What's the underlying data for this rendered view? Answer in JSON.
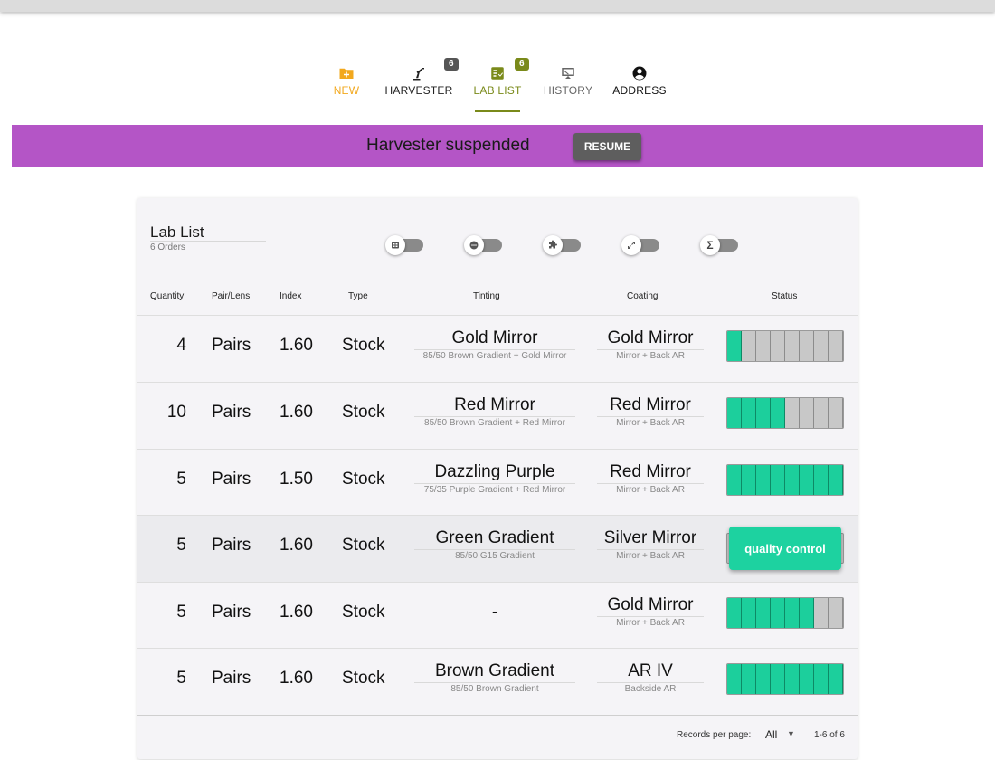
{
  "nav": {
    "items": [
      {
        "label": "NEW",
        "icon": "folder-plus-icon",
        "color": "#f2a81d"
      },
      {
        "label": "HARVESTER",
        "icon": "robot-arm-icon",
        "color": "#222222",
        "badge": "6",
        "badge_color": "#555555"
      },
      {
        "label": "LAB LIST",
        "icon": "checklist-icon",
        "color": "#7a8a1a",
        "badge": "6",
        "badge_color": "#7a8a1a",
        "active": true
      },
      {
        "label": "HISTORY",
        "icon": "history-icon",
        "color": "#666666"
      },
      {
        "label": "ADDRESS",
        "icon": "account-circle-icon",
        "color": "#111111"
      }
    ]
  },
  "banner": {
    "text": "Harvester suspended",
    "button": "RESUME",
    "color": "#b455c6"
  },
  "lab_list": {
    "title": "Lab List",
    "subtitle": "6 Orders",
    "toggles": [
      "grid-icon",
      "dots-icon",
      "puzzle-icon",
      "expand-icon",
      "sigma-icon"
    ],
    "columns": [
      "Quantity",
      "Pair/Lens",
      "Index",
      "Type",
      "Tinting",
      "Coating",
      "Status"
    ],
    "rows": [
      {
        "quantity": "4",
        "unit": "Pairs",
        "index": "1.60",
        "type": "Stock",
        "tint": "Gold Mirror",
        "tint_sub": "85/50 Brown Gradient + Gold Mirror",
        "coat": "Gold Mirror",
        "coat_sub": "Mirror + Back AR",
        "progress": 1,
        "segments": 8
      },
      {
        "quantity": "10",
        "unit": "Pairs",
        "index": "1.60",
        "type": "Stock",
        "tint": "Red Mirror",
        "tint_sub": "85/50 Brown Gradient + Red Mirror",
        "coat": "Red Mirror",
        "coat_sub": "Mirror + Back AR",
        "progress": 4,
        "segments": 8
      },
      {
        "quantity": "5",
        "unit": "Pairs",
        "index": "1.50",
        "type": "Stock",
        "tint": "Dazzling Purple",
        "tint_sub": "75/35 Purple Gradient + Red Mirror",
        "coat": "Red Mirror",
        "coat_sub": "Mirror + Back AR",
        "progress": 8,
        "segments": 8
      },
      {
        "quantity": "5",
        "unit": "Pairs",
        "index": "1.60",
        "type": "Stock",
        "tint": "Green Gradient",
        "tint_sub": "85/50 G15 Gradient",
        "coat": "Silver Mirror",
        "coat_sub": "Mirror + Back AR",
        "status_label": "quality control",
        "highlight": true
      },
      {
        "quantity": "5",
        "unit": "Pairs",
        "index": "1.60",
        "type": "Stock",
        "tint": "-",
        "tint_sub": "",
        "coat": "Gold Mirror",
        "coat_sub": "Mirror + Back AR",
        "progress": 6,
        "segments": 8
      },
      {
        "quantity": "5",
        "unit": "Pairs",
        "index": "1.60",
        "type": "Stock",
        "tint": "Brown Gradient",
        "tint_sub": "85/50 Brown Gradient",
        "coat": "AR IV",
        "coat_sub": "Backside AR",
        "progress": 8,
        "segments": 8
      }
    ],
    "footer": {
      "records_label": "Records per page:",
      "records_value": "All",
      "range": "1-6 of 6"
    }
  }
}
